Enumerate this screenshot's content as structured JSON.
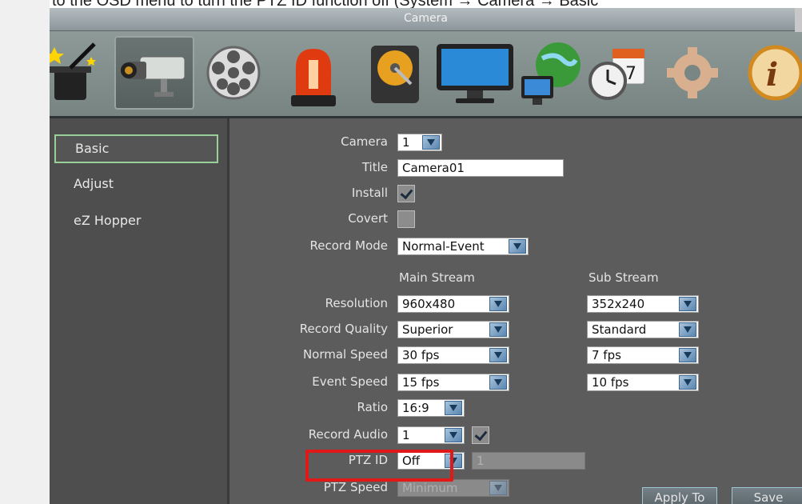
{
  "caption": "to the OSD menu to turn the PTZ ID function off (System → Camera → Basic",
  "window_title": "Camera",
  "toolbar": {
    "tools": [
      "wizard-icon",
      "camera-icon",
      "film-reel-icon",
      "alarm-light-icon",
      "hard-disk-icon",
      "monitor-icon",
      "network-icon",
      "schedule-icon",
      "gear-icon",
      "info-icon"
    ],
    "active": "camera-icon"
  },
  "sidebar": {
    "items": [
      {
        "label": "Basic",
        "active": true
      },
      {
        "label": "Adjust",
        "active": false
      },
      {
        "label": "eZ Hopper",
        "active": false
      }
    ]
  },
  "form": {
    "camera_label": "Camera",
    "camera_value": "1",
    "title_label": "Title",
    "title_value": "Camera01",
    "install_label": "Install",
    "install_checked": true,
    "covert_label": "Covert",
    "covert_checked": false,
    "record_mode_label": "Record Mode",
    "record_mode_value": "Normal-Event",
    "main_stream_header": "Main Stream",
    "sub_stream_header": "Sub Stream",
    "resolution_label": "Resolution",
    "resolution_main": "960x480",
    "resolution_sub": "352x240",
    "quality_label": "Record Quality",
    "quality_main": "Superior",
    "quality_sub": "Standard",
    "normal_speed_label": "Normal Speed",
    "normal_speed_main": "30 fps",
    "normal_speed_sub": "7 fps",
    "event_speed_label": "Event Speed",
    "event_speed_main": "15 fps",
    "event_speed_sub": "10 fps",
    "ratio_label": "Ratio",
    "ratio_value": "16:9",
    "record_audio_label": "Record Audio",
    "record_audio_value": "1",
    "record_audio_checked": true,
    "ptz_id_label": "PTZ ID",
    "ptz_id_value": "Off",
    "ptz_id_number": "1",
    "ptz_speed_label": "PTZ Speed",
    "ptz_speed_value": "Minimum"
  },
  "buttons": {
    "apply_to": "Apply To",
    "save": "Save"
  },
  "colors": {
    "highlight": "#e01818",
    "selected_border": "#99d099",
    "dropdown_blue": "#5a86b0"
  }
}
